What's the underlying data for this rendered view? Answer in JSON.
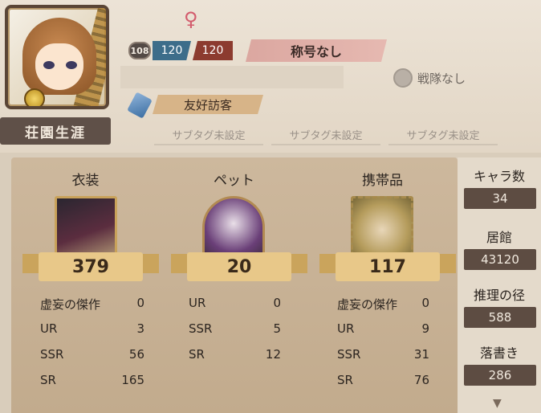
{
  "profile": {
    "career_tag": "荘園生涯",
    "gender_symbol": "♀",
    "level": "108",
    "rank_blue": "120",
    "rank_red": "120",
    "title": "称号なし",
    "team": "戦隊なし",
    "friend_tag": "友好訪客",
    "subtags": [
      "サブタグ未設定",
      "サブタグ未設定",
      "サブタグ未設定"
    ]
  },
  "columns": [
    {
      "label": "衣装",
      "count": "379",
      "stats": [
        {
          "name": "虚妄の傑作",
          "value": "0"
        },
        {
          "name": "UR",
          "value": "3"
        },
        {
          "name": "SSR",
          "value": "56"
        },
        {
          "name": "SR",
          "value": "165"
        }
      ]
    },
    {
      "label": "ペット",
      "count": "20",
      "stats": [
        {
          "name": "UR",
          "value": "0"
        },
        {
          "name": "SSR",
          "value": "5"
        },
        {
          "name": "SR",
          "value": "12"
        }
      ]
    },
    {
      "label": "携帯品",
      "count": "117",
      "stats": [
        {
          "name": "虚妄の傑作",
          "value": "0"
        },
        {
          "name": "UR",
          "value": "9"
        },
        {
          "name": "SSR",
          "value": "31"
        },
        {
          "name": "SR",
          "value": "76"
        }
      ]
    }
  ],
  "side": [
    {
      "label": "キャラ数",
      "value": "34"
    },
    {
      "label": "居館",
      "value": "43120"
    },
    {
      "label": "推理の径",
      "value": "588"
    },
    {
      "label": "落書き",
      "value": "286"
    }
  ],
  "icons": {
    "gender": "female-icon",
    "more": "chevron-down-icon"
  }
}
